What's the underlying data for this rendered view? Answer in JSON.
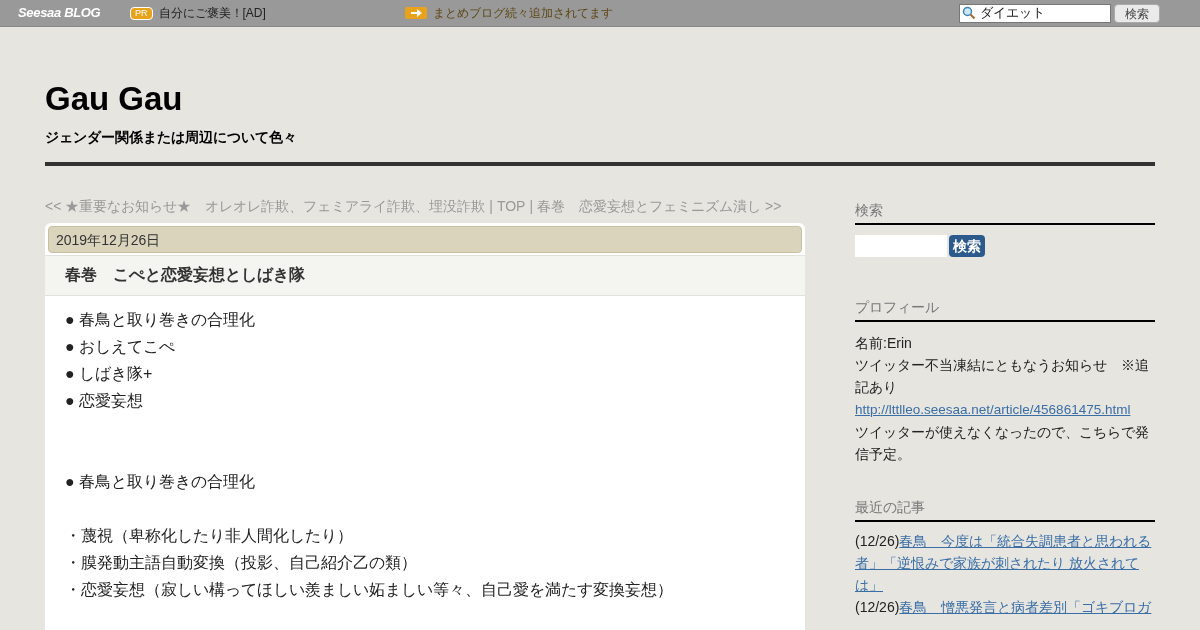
{
  "topbar": {
    "logo": "Seesaa BLOG",
    "pr_badge": "PR",
    "ad_text": "自分にご褒美！[AD]",
    "notice": "まとめブログ続々追加されてます",
    "search_value": "ダイエット",
    "search_button": "検索"
  },
  "blog": {
    "title": "Gau Gau",
    "tagline": "ジェンダー関係または周辺について色々"
  },
  "nav": {
    "prev": "<< ★重要なお知らせ★　オレオレ詐欺、フェミアライ詐欺、埋没詐欺",
    "separator_1": "|",
    "top": "TOP",
    "separator_2": "|",
    "next": "春巻　恋愛妄想とフェミニズム潰し >>"
  },
  "article": {
    "date": "2019年12月26日",
    "title": "春巻　こぺと恋愛妄想としばき隊",
    "lines": [
      {
        "kind": "text",
        "text": "● 春鳥と取り巻きの合理化"
      },
      {
        "kind": "text",
        "text": "● おしえてこぺ"
      },
      {
        "kind": "text",
        "text": "● しばき隊+"
      },
      {
        "kind": "text",
        "text": "● 恋愛妄想"
      },
      {
        "kind": "blank"
      },
      {
        "kind": "blank"
      },
      {
        "kind": "text",
        "text": "● 春鳥と取り巻きの合理化"
      },
      {
        "kind": "blank"
      },
      {
        "kind": "text",
        "text": "・蔑視（卑称化したり非人間化したり）"
      },
      {
        "kind": "text",
        "text": "・膜発動主語自動変換（投影、自己紹介乙の類）"
      },
      {
        "kind": "text",
        "text": "・恋愛妄想（寂しい構ってほしい羨ましい妬ましい等々、自己愛を満たす変換妄想）"
      }
    ]
  },
  "sidebar": {
    "search": {
      "heading": "検索",
      "button": "検索"
    },
    "profile": {
      "heading": "プロフィール",
      "name": "名前:Erin",
      "notice": "ツイッター不当凍結にともなうお知らせ　※追記あり",
      "link": "http://lttlleo.seesaa.net/article/456861475.html",
      "note": "ツイッターが使えなくなったので、こちらで発信予定。"
    },
    "recent": {
      "heading": "最近の記事",
      "items": [
        {
          "date": "(12/26)",
          "title": "春鳥　今度は「統合失調患者と思われる者」「逆恨みで家族が刺されたり 放火されては」"
        },
        {
          "date": "(12/26)",
          "title": "春鳥　憎悪発言と病者差別「ゴキブロガ"
        }
      ]
    }
  }
}
